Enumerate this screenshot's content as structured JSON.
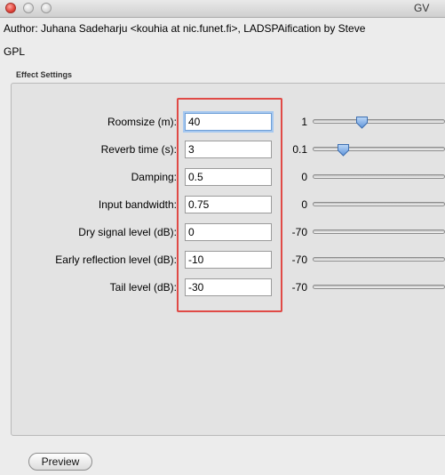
{
  "window": {
    "title": "GV"
  },
  "plugin": {
    "author_line": "Author: Juhana Sadeharju <kouhia at nic.funet.fi>, LADSPAification by Steve",
    "license": "GPL"
  },
  "settings": {
    "section_title": "Effect Settings",
    "rows": [
      {
        "label": "Roomsize (m):",
        "value": "40",
        "min": "1",
        "slider": 0.36
      },
      {
        "label": "Reverb time (s):",
        "value": "3",
        "min": "0.1",
        "slider": 0.22
      },
      {
        "label": "Damping:",
        "value": "0.5",
        "min": "0",
        "slider": null
      },
      {
        "label": "Input bandwidth:",
        "value": "0.75",
        "min": "0",
        "slider": null
      },
      {
        "label": "Dry signal level (dB):",
        "value": "0",
        "min": "-70",
        "slider": null
      },
      {
        "label": "Early reflection level (dB):",
        "value": "-10",
        "min": "-70",
        "slider": null
      },
      {
        "label": "Tail level (dB):",
        "value": "-30",
        "min": "-70",
        "slider": null
      }
    ]
  },
  "buttons": {
    "preview": "Preview"
  },
  "colors": {
    "highlight": "#e04a46",
    "focus": "#6f9fd6",
    "thumb": "#5e93d9"
  }
}
